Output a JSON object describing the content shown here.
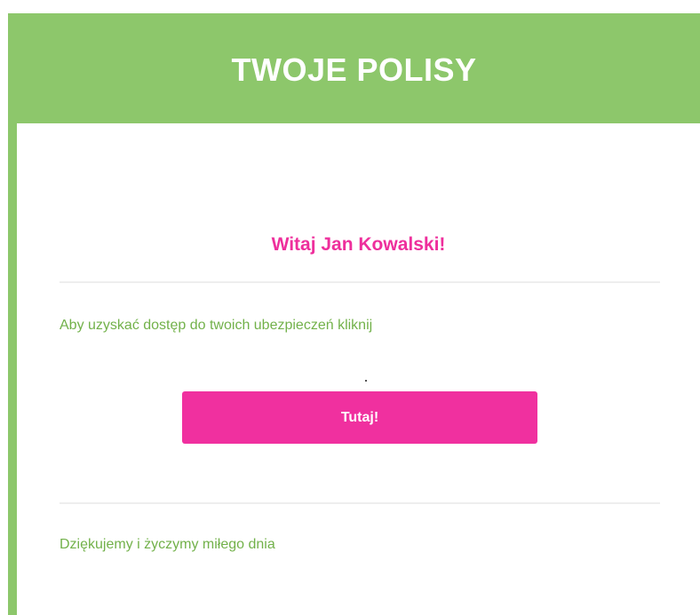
{
  "header": {
    "title": "TWOJE POLISY"
  },
  "main": {
    "greeting": "Witaj Jan Kowalski!",
    "instruction": "Aby uzyskać dostęp do twoich ubezpieczeń kliknij",
    "button_label": "Tutaj!",
    "closing": "Dziękujemy i życzymy miłego dnia"
  },
  "colors": {
    "brand_green": "#8dc76b",
    "text_green": "#72b14a",
    "accent_pink": "#f0309f"
  }
}
